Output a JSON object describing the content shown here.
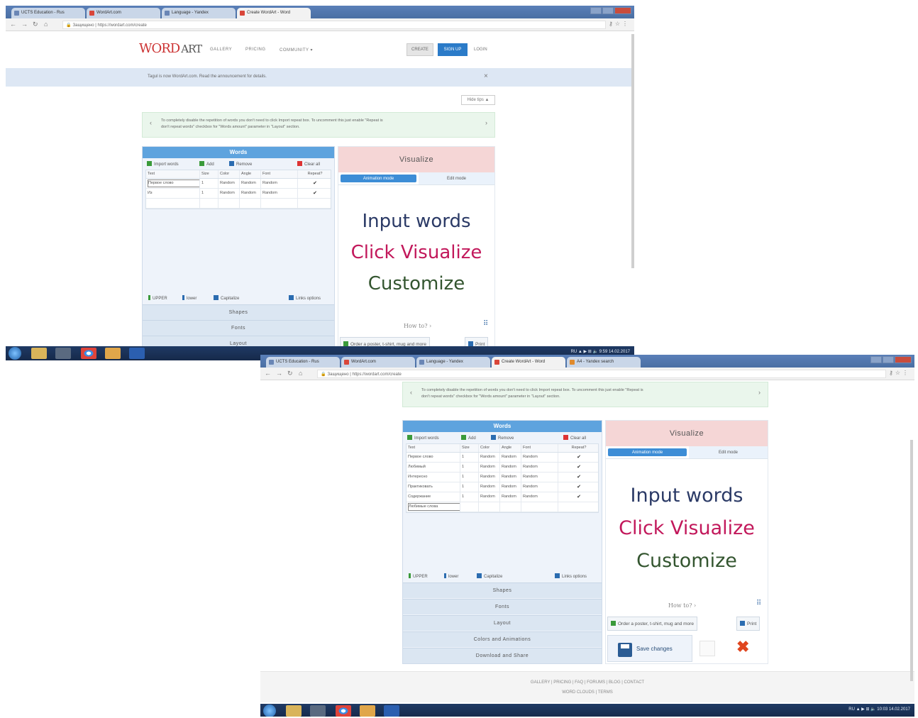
{
  "browser": {
    "tabs": [
      "UCTS Education - Rus",
      "WordArt.com",
      "Language - Yandex",
      "Create WordArt - Word"
    ],
    "tabs2": [
      "UCTS Education - Rus",
      "WordArt.com",
      "Language - Yandex",
      "Create WordArt - Word",
      "A4 - Yandex search"
    ],
    "secure_label": "Защищено",
    "url": "https://wordart.com/create"
  },
  "site": {
    "logo": {
      "word": "WORD",
      "art": "ART"
    },
    "nav": [
      "GALLERY",
      "PRICING",
      "COMMUNITY ▾"
    ],
    "create_label": "CREATE",
    "signup_label": "SIGN UP",
    "login_label": "LOGIN",
    "announcement": "Tagul is now WordArt.com. Read the announcement for details.",
    "close_glyph": "×",
    "hide_label": "Hide tips ▲",
    "tip_line1": "To completely disable the repetition of words you don't need to click Import repeat box. To uncomment this just enable \"Repeat is",
    "tip_line2": "don't repeat words\" checkbox for \"Words amount\" parameter in \"Layout\" section.",
    "tip_prev": "‹",
    "tip_next": "›"
  },
  "words_panel": {
    "title": "Words",
    "import_label": "Import words",
    "add_label": "Add",
    "remove_label": "Remove",
    "clear_label": "Clear all",
    "columns": [
      "Text",
      "Size",
      "Color",
      "Angle",
      "Font",
      "Repeat?"
    ],
    "rows_shot1": [
      {
        "text": "Первое слово",
        "size": "1",
        "color": "Random",
        "angle": "Random",
        "font": "Random",
        "repeat": "✔"
      },
      {
        "text": "Из",
        "size": "1",
        "color": "Random",
        "angle": "Random",
        "font": "Random",
        "repeat": "✔"
      }
    ],
    "rows_shot2": [
      {
        "text": "Первое слово",
        "size": "1",
        "color": "Random",
        "angle": "Random",
        "font": "Random",
        "repeat": "✔"
      },
      {
        "text": "Любимый",
        "size": "1",
        "color": "Random",
        "angle": "Random",
        "font": "Random",
        "repeat": "✔"
      },
      {
        "text": "Интересно",
        "size": "1",
        "color": "Random",
        "angle": "Random",
        "font": "Random",
        "repeat": "✔"
      },
      {
        "text": "Практиковать",
        "size": "1",
        "color": "Random",
        "angle": "Random",
        "font": "Random",
        "repeat": "✔"
      },
      {
        "text": "Содержание",
        "size": "1",
        "color": "Random",
        "angle": "Random",
        "font": "Random",
        "repeat": "✔"
      }
    ],
    "new_row_value": "Любимые слова",
    "upper_label": "UPPER",
    "lower_label": "lower",
    "capitalize_label": "Capitalize",
    "links_label": "Links options",
    "sections": [
      "Shapes",
      "Fonts",
      "Layout",
      "Colors and Animations",
      "Download and Share"
    ]
  },
  "visualize_panel": {
    "title": "Visualize",
    "tab_animation": "Animation mode",
    "tab_edit": "Edit mode",
    "line1": "Input words",
    "line2": "Click Visualize",
    "line3": "Customize",
    "howto": "How to?",
    "qr_glyph": "⠿",
    "order_label": "Order a poster, t-shirt, mug and more",
    "print_label": "Print",
    "save_label": "Save changes",
    "cancel_glyph": "✖"
  },
  "footer": {
    "links": "GALLERY  |  PRICING  |  FAQ  |  FORUMS  |  BLOG  |  CONTACT",
    "sub": "WORD CLOUDS  |  TERMS"
  },
  "taskbar": {
    "tray1": "RU ▲ ▶ ⊞ 🔈  9:59  14.02.2017",
    "tray2": "RU ▲ ▶ ⊞ 🔈  10:03  14.02.2017"
  },
  "colors": {
    "accent": "#2b7bc8",
    "words_header": "#5ea3de",
    "visualize_header": "#f5d6d6",
    "line1": "#2b3a66",
    "line2": "#c2185b",
    "line3": "#33552f"
  }
}
